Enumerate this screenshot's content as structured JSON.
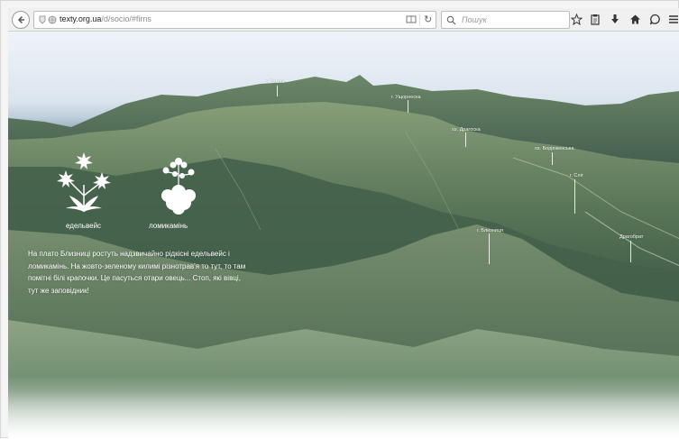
{
  "browser": {
    "url_domain": "texty.org.ua",
    "url_path": "/d/socio/#firns",
    "search_placeholder": "Пошук"
  },
  "icons": [
    "back-icon",
    "info-icon",
    "globe-icon",
    "reader-icon",
    "reload-icon",
    "search-icon",
    "star-icon",
    "clipboard-icon",
    "download-icon",
    "home-icon",
    "chat-icon",
    "menu-icon",
    "edelweiss-icon",
    "saxifrage-icon"
  ],
  "flowers": [
    {
      "name": "едельвейс"
    },
    {
      "name": "ломикамінь"
    }
  ],
  "story": "На плато Близниці ростуть надзвичайно рідкісні едельвейс і ломикамінь. На жовто-зеленому килимі різнотрав'я то тут, то там помітні білі крапочки. Це пасуться отари овець... Стоп, які вівці, тут же заповідник!",
  "peaks": [
    "г. Тимпа",
    "г. Ущорнескa",
    "оз. Драгоска",
    "оз. Борjеженська",
    "г. Сліг",
    "г. Близниця",
    "Драгобрат"
  ]
}
